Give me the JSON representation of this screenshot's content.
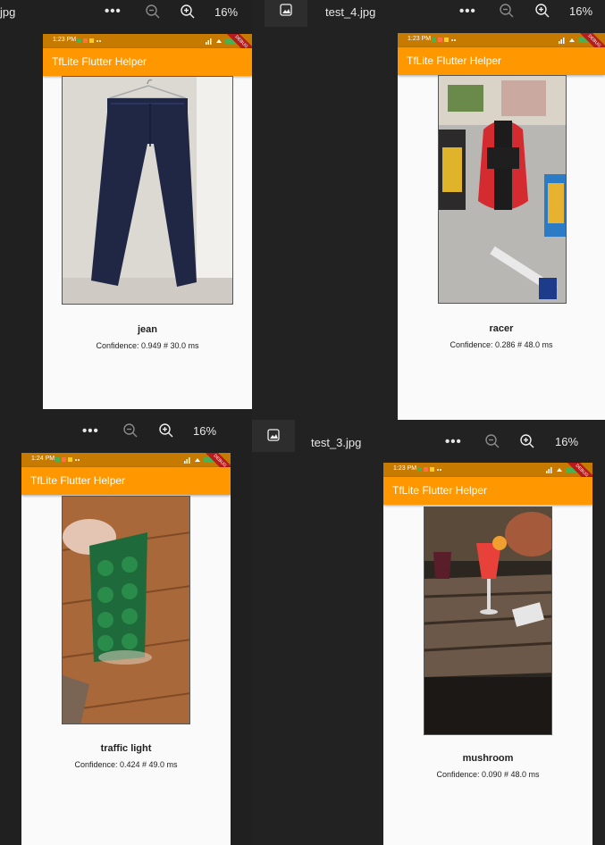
{
  "viewers": [
    {
      "filename": "jpg",
      "zoom": "16%",
      "app_title": "TfLite Flutter Helper",
      "time": "1:23 PM",
      "prediction": "jean",
      "confidence": "Confidence: 0.949 # 30.0 ms"
    },
    {
      "filename": "test_4.jpg",
      "zoom": "16%",
      "app_title": "TfLite Flutter Helper",
      "time": "1:23 PM",
      "prediction": "racer",
      "confidence": "Confidence: 0.286 # 48.0 ms"
    },
    {
      "filename": "",
      "zoom": "16%",
      "app_title": "TfLite Flutter Helper",
      "time": "1:24 PM",
      "prediction": "traffic light",
      "confidence": "Confidence: 0.424 # 49.0 ms"
    },
    {
      "filename": "test_3.jpg",
      "zoom": "16%",
      "app_title": "TfLite Flutter Helper",
      "time": "1:23 PM",
      "prediction": "mushroom",
      "confidence": "Confidence: 0.090 # 48.0 ms"
    }
  ],
  "toolbar": {
    "more_label": "•••"
  },
  "debug_banner": "DEBUG",
  "colors": {
    "appbar": "#ff9800",
    "statusbar": "#c77a00",
    "viewer_bg": "#202020"
  },
  "icons": [
    "more-options-icon",
    "zoom-out-icon",
    "zoom-in-icon",
    "photo-icon"
  ]
}
